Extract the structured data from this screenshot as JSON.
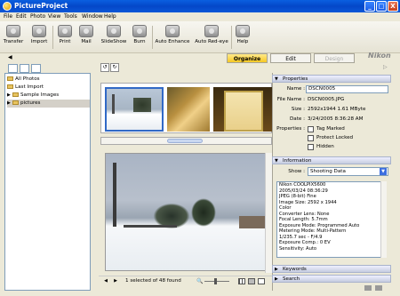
{
  "window": {
    "title": "PictureProject",
    "minimize": "_",
    "maximize": "□",
    "close": "X"
  },
  "menu": [
    "File",
    "Edit",
    "Photo",
    "View",
    "Tools",
    "Window",
    "Help"
  ],
  "toolbar": {
    "items": [
      "Transfer",
      "Import",
      "Print",
      "Mail",
      "SlideShow",
      "Burn",
      "Auto Enhance",
      "Auto Red-eye",
      "Help"
    ]
  },
  "tabs": {
    "organize": "Organize",
    "edit": "Edit",
    "design": "Design"
  },
  "brand": "Nikon",
  "tree": {
    "all_photos": "All Photos",
    "last_import": "Last Import",
    "sample_images": "Sample Images",
    "pictures": "pictures"
  },
  "properties": {
    "header": "Properties",
    "name_label": "Name :",
    "name_value": "DSCN0005",
    "filename_label": "File Name :",
    "filename_value": "DSCN0005.JPG",
    "size_label": "Size :",
    "size_value": "2592x1944   1.61 MByte",
    "date_label": "Date :",
    "date_value": "3/24/2005 8:36:28 AM",
    "props_label": "Properties :",
    "tag_marked": "Tag Marked",
    "protect_locked": "Protect Locked",
    "hidden": "Hidden"
  },
  "information": {
    "header": "Information",
    "show_label": "Show :",
    "show_value": "Shooting Data",
    "lines": [
      "Nikon COOLPIX5600",
      "2005/03/24 08:36:29",
      "JPEG (8-bit) Fine",
      "Image Size: 2592 x 1944",
      "Color",
      "Converter Lens: None",
      "Focal Length: 5.7mm",
      "Exposure Mode: Programmed Auto",
      "Metering Mode: Multi-Pattern",
      "1/235.7 sec - F/4.9",
      "Exposure Comp.: 0 EV",
      "Sensitivity: Auto"
    ]
  },
  "keywords": "Keywords",
  "search": "Search",
  "status": {
    "count": "1 selected of 48 found"
  }
}
